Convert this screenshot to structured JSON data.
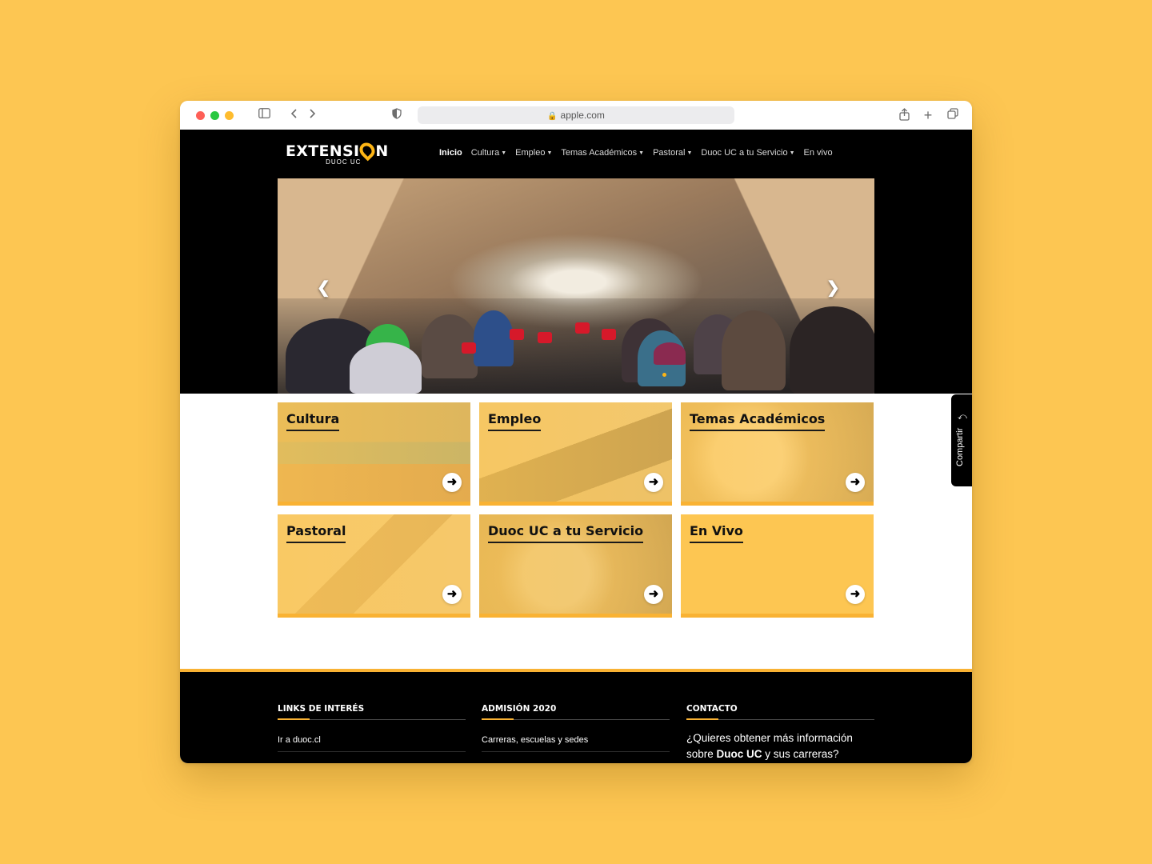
{
  "browser": {
    "url": "apple.com"
  },
  "site": {
    "logo": {
      "main_before": "EXTENSI",
      "main_after": "N",
      "sub": "DUOC UC"
    },
    "nav": [
      {
        "label": "Inicio",
        "active": true,
        "dropdown": false
      },
      {
        "label": "Cultura",
        "active": false,
        "dropdown": true
      },
      {
        "label": "Empleo",
        "active": false,
        "dropdown": true
      },
      {
        "label": "Temas Académicos",
        "active": false,
        "dropdown": true
      },
      {
        "label": "Pastoral",
        "active": false,
        "dropdown": true
      },
      {
        "label": "Duoc UC a tu Servicio",
        "active": false,
        "dropdown": true
      },
      {
        "label": "En vivo",
        "active": false,
        "dropdown": false
      }
    ],
    "hero": {
      "prev_icon": "chevron-left-icon",
      "next_icon": "chevron-right-icon"
    },
    "cards": [
      {
        "title": "Cultura"
      },
      {
        "title": "Empleo"
      },
      {
        "title": "Temas Académicos"
      },
      {
        "title": "Pastoral"
      },
      {
        "title": "Duoc UC a tu Servicio"
      },
      {
        "title": "En Vivo"
      }
    ],
    "share": {
      "label": "Compartir"
    },
    "footer": {
      "links": {
        "heading": "LINKS DE INTERÉS",
        "item": "Ir a duoc.cl"
      },
      "admission": {
        "heading": "ADMISIÓN 2020",
        "item": "Carreras, escuelas y sedes"
      },
      "contact": {
        "heading": "CONTACTO",
        "text_before": "¿Quieres obtener más información sobre ",
        "text_bold": "Duoc UC",
        "text_after": " y sus carreras?"
      }
    }
  },
  "colors": {
    "background": "#FDC652",
    "accent": "#F9B233",
    "brand_yellow": "#FDB515"
  }
}
